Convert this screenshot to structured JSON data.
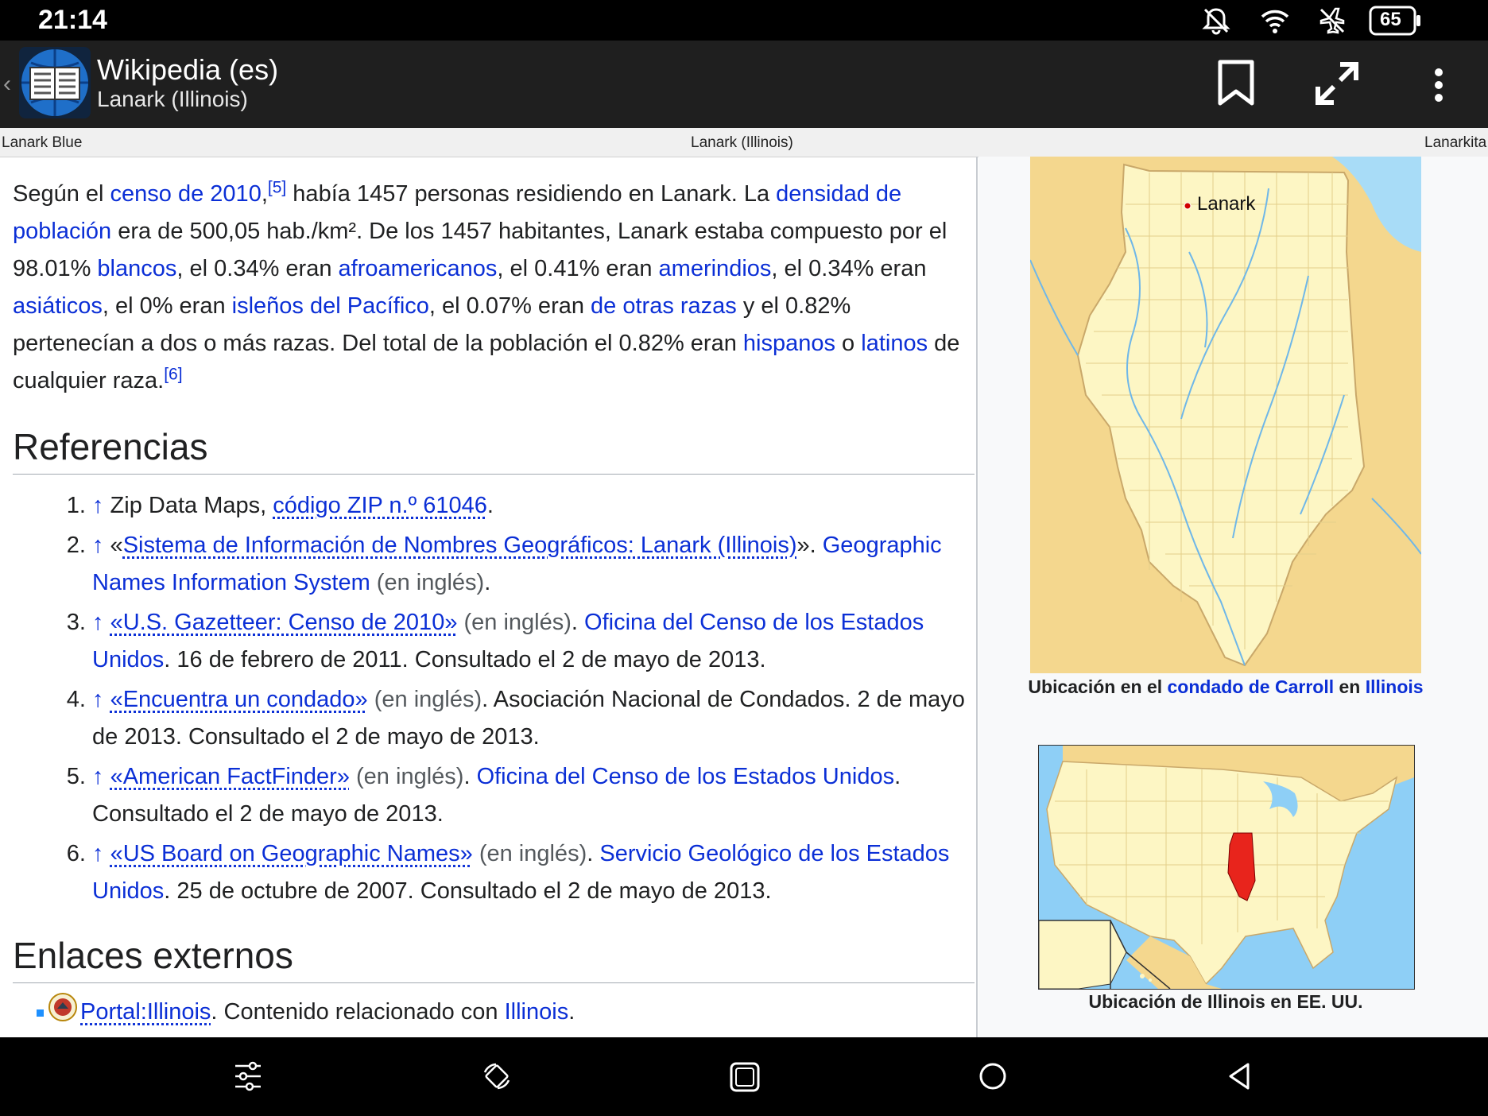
{
  "status": {
    "time": "21:14",
    "battery": "65"
  },
  "app": {
    "title": "Wikipedia (es)",
    "subtitle": "Lanark (Illinois)"
  },
  "tabs": {
    "prev": "Lanark Blue",
    "current": "Lanark (Illinois)",
    "next": "Lanarkita"
  },
  "article": {
    "p1": "Según el ",
    "censo": "censo de 2010",
    "p2": ",",
    "ref5": "[5]",
    "p3": " había 1457 personas residiendo en Lanark. La ",
    "densidad": "densidad de población",
    "p4": " era de 500,05 hab./km². De los 1457 habitantes, Lanark estaba compuesto por el 98.01% ",
    "blancos": "blancos",
    "p5": ", el 0.34% eran ",
    "afro": "afroamericanos",
    "p6": ", el 0.41% eran ",
    "amerindios": "amerindios",
    "p7": ", el 0.34% eran ",
    "asiaticos": "asiáticos",
    "p8": ", el 0% eran ",
    "islenos": "isleños del Pacífico",
    "p9": ", el 0.07% eran ",
    "otras": "de otras razas",
    "p10": " y el 0.82% pertenecían a dos o más razas. Del total de la población el 0.82% eran ",
    "hispanos": "hispanos",
    "p11": " o ",
    "latinos": "latinos",
    "p12": " de cualquier raza.",
    "ref6": "[6]"
  },
  "references": {
    "heading": "Referencias",
    "arrow": "↑",
    "items": [
      {
        "a": " Zip Data Maps, ",
        "link": "código ZIP n.º 61046",
        "b": "."
      },
      {
        "a": " «",
        "link": "Sistema de Información de Nombres Geográficos: Lanark (Illinois)",
        "b": "». ",
        "link2": "Geographic Names Information System",
        "lang": " (en inglés)",
        "c": "."
      },
      {
        "link": "«U.S. Gazetteer: Censo de 2010»",
        "lang": " (en inglés)",
        "b": ". ",
        "link2": "Oficina del Censo de los Estados Unidos",
        "c": ". 16 de febrero de 2011. Consultado el 2 de mayo de 2013."
      },
      {
        "link": "«Encuentra un condado»",
        "lang": " (en inglés)",
        "b": ". Asociación Nacional de Condados. 2 de mayo de 2013. Consultado el 2 de mayo de 2013."
      },
      {
        "link": "«American FactFinder»",
        "lang": " (en inglés)",
        "b": ". ",
        "link2": "Oficina del Censo de los Estados Unidos",
        "c": ". Consultado el 2 de mayo de 2013."
      },
      {
        "link": "«US Board on Geographic Names»",
        "lang": " (en inglés)",
        "b": ". ",
        "link2": "Servicio Geológico de los Estados Unidos",
        "c": ". 25 de octubre de 2007. Consultado el 2 de mayo de 2013."
      }
    ]
  },
  "external": {
    "heading": "Enlaces externos",
    "portal": "Portal:Illinois",
    "text": ". Contenido relacionado con ",
    "illinois": "Illinois",
    "end": "."
  },
  "infobox": {
    "map1_label": "Lanark",
    "cap1_a": "Ubicación en el ",
    "cap1_link": "condado de Carroll",
    "cap1_b": " en ",
    "cap1_link2": "Illinois",
    "cap2": "Ubicación de Illinois en EE. UU."
  },
  "colors": {
    "link": "#0b2fd6",
    "land": "#fdf6c4",
    "surround": "#f4d78e",
    "water": "#8ecff6",
    "highlight": "#e8241c"
  }
}
